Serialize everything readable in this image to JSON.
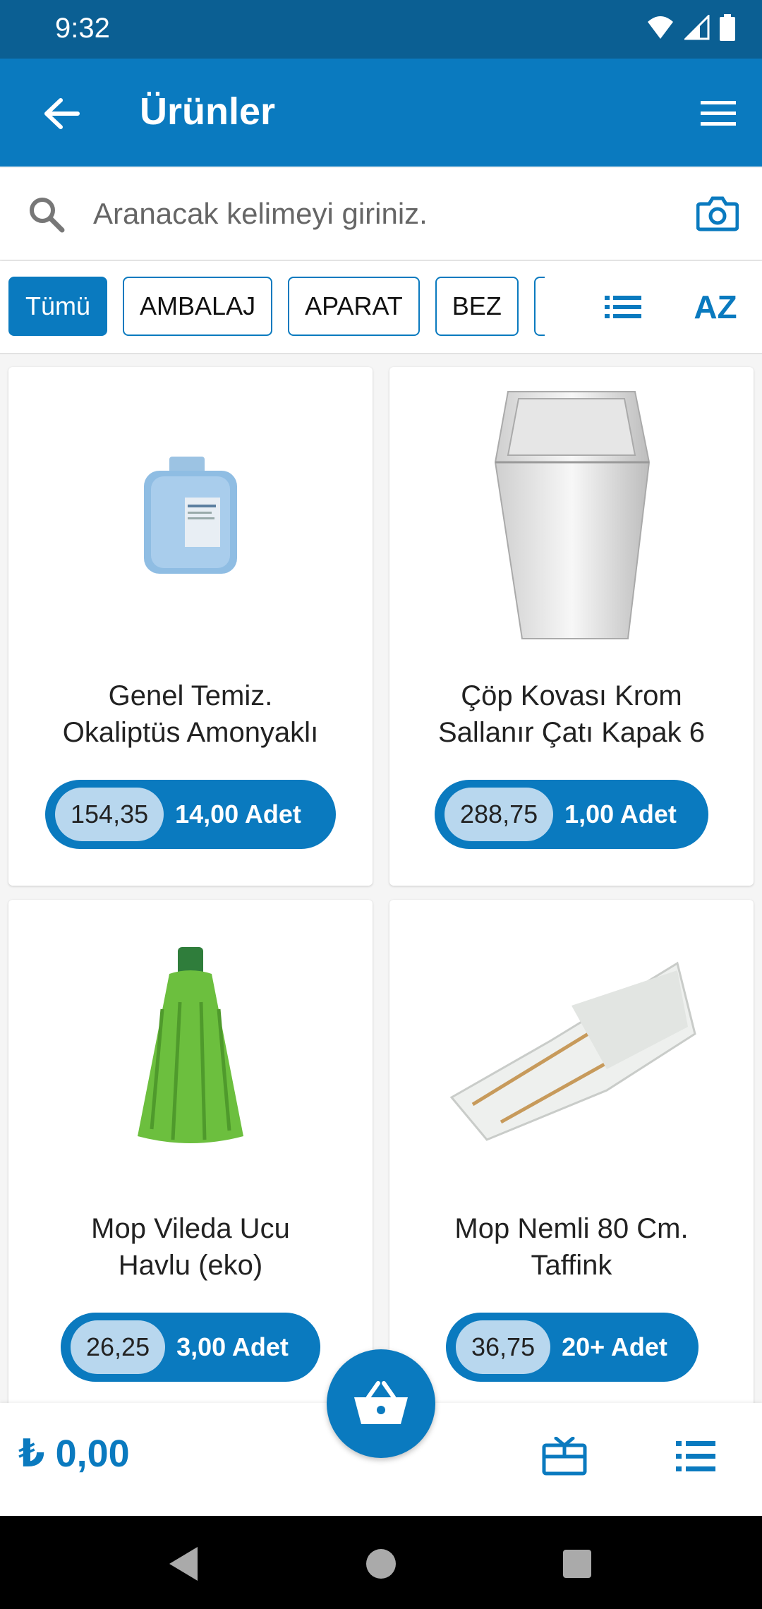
{
  "status": {
    "time": "9:32"
  },
  "header": {
    "title": "Ürünler"
  },
  "search": {
    "placeholder": "Aranacak kelimeyi giriniz."
  },
  "filters": {
    "chips": [
      {
        "label": "Tümü",
        "active": true
      },
      {
        "label": "AMBALAJ"
      },
      {
        "label": "APARAT"
      },
      {
        "label": "BEZ"
      }
    ],
    "sort_label": "AZ"
  },
  "products": [
    {
      "name": "Genel Temiz.\nOkaliptüs Amonyaklı",
      "price": "154,35",
      "quantity": "14,00 Adet",
      "image_icon": "jerrycan-icon"
    },
    {
      "name": "Çöp Kovası Krom\nSallanır Çatı Kapak  6",
      "price": "288,75",
      "quantity": "1,00 Adet",
      "image_icon": "trash-bin-icon"
    },
    {
      "name": "Mop Vileda Ucu\nHavlu (eko)",
      "price": "26,25",
      "quantity": "3,00 Adet",
      "image_icon": "mop-head-icon"
    },
    {
      "name": "Mop Nemli 80 Cm.\nTaffink",
      "price": "36,75",
      "quantity": "20+ Adet",
      "image_icon": "flat-mop-icon"
    }
  ],
  "cart": {
    "total": "₺ 0,00"
  },
  "colors": {
    "primary": "#0a7abf",
    "status_bar": "#0b5f93",
    "price_bg": "#b8d7ee"
  }
}
